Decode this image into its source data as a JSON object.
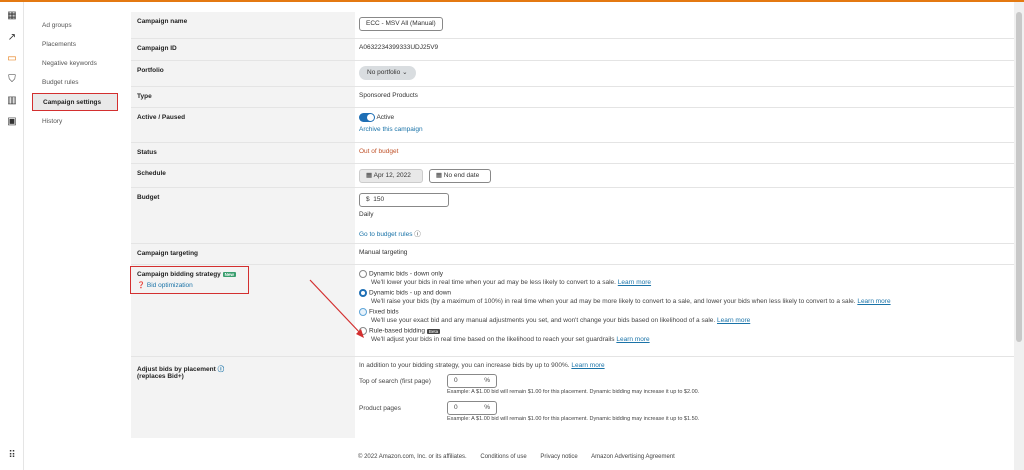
{
  "rail": {
    "icons": [
      "dashboard-icon",
      "trend-icon",
      "campaign-icon",
      "shield-icon",
      "reports-icon",
      "media-icon",
      "apps-grid-icon"
    ]
  },
  "subnav": {
    "items": [
      {
        "label": "Ad groups"
      },
      {
        "label": "Placements"
      },
      {
        "label": "Negative keywords"
      },
      {
        "label": "Budget rules"
      },
      {
        "label": "Campaign settings"
      },
      {
        "label": "History"
      }
    ]
  },
  "settings": {
    "campaign_name": {
      "label": "Campaign name",
      "value": "ECC - MSV All (Manual)"
    },
    "campaign_id": {
      "label": "Campaign ID",
      "value": "A0632234399333UDJ25V9"
    },
    "portfolio": {
      "label": "Portfolio",
      "value": "No portfolio"
    },
    "type": {
      "label": "Type",
      "value": "Sponsored Products"
    },
    "active": {
      "label": "Active / Paused",
      "value": "Active",
      "archive_link": "Archive this campaign"
    },
    "status": {
      "label": "Status",
      "value": "Out of budget"
    },
    "schedule": {
      "label": "Schedule",
      "start": "Apr 12, 2022",
      "end": "No end date"
    },
    "budget": {
      "label": "Budget",
      "currency": "$",
      "value": "150",
      "period": "Daily",
      "rules_link": "Go to budget rules"
    },
    "targeting": {
      "label": "Campaign targeting",
      "value": "Manual targeting"
    },
    "bidding": {
      "label": "Campaign bidding strategy",
      "badge": "New",
      "help_link": "Bid optimization",
      "options": [
        {
          "title": "Dynamic bids - down only",
          "desc": "We'll lower your bids in real time when your ad may be less likely to convert to a sale.",
          "link": "Learn more"
        },
        {
          "title": "Dynamic bids - up and down",
          "desc": "We'll raise your bids (by a maximum of 100%) in real time when your ad may be more likely to convert to a sale, and lower your bids when less likely to convert to a sale.",
          "link": "Learn more"
        },
        {
          "title": "Fixed bids",
          "desc": "We'll use your exact bid and any manual adjustments you set, and won't change your bids based on likelihood of a sale.",
          "link": "Learn more"
        },
        {
          "title": "Rule-based bidding",
          "badge": "Beta",
          "desc": "We'll adjust your bids in real time based on the likelihood to reach your set guardrails",
          "link": "Learn more"
        }
      ],
      "selected": "Dynamic bids - up and down"
    },
    "placement": {
      "label": "Adjust bids by placement",
      "sublabel": "(replaces Bid+)",
      "intro": "In addition to your bidding strategy, you can increase bids by up to 900%.",
      "intro_link": "Learn more",
      "top": {
        "label": "Top of search (first page)",
        "value": "0",
        "unit": "%",
        "example": "Example: A $1.00 bid will remain $1.00 for this placement. Dynamic bidding may increase it up to $2.00."
      },
      "product": {
        "label": "Product pages",
        "value": "0",
        "unit": "%",
        "example": "Example: A $1.00 bid will remain $1.00 for this placement. Dynamic bidding may increase it up to $1.50."
      }
    }
  },
  "footer": {
    "copyright": "© 2022 Amazon.com, Inc. or its affiliates.",
    "links": [
      "Conditions of use",
      "Privacy notice",
      "Amazon Advertising Agreement"
    ]
  }
}
